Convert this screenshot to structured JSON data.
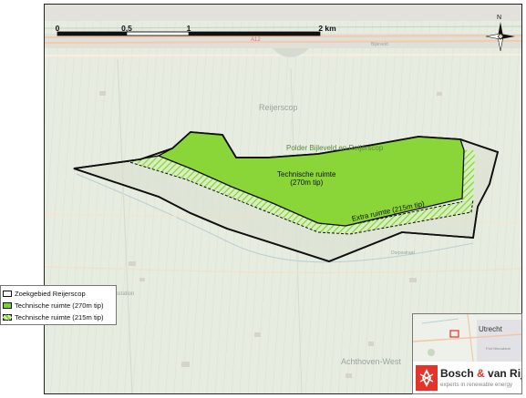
{
  "map": {
    "scale_bar": {
      "ticks": [
        {
          "label": "0"
        },
        {
          "label": "0,5"
        },
        {
          "label": "1"
        },
        {
          "label": "2 km"
        }
      ]
    },
    "north_label": "N",
    "place_labels": {
      "reijerscop": "Reijerscop",
      "polder": "Polder Bijleveld en Reijerscop",
      "achthoven": "Achthoven-West",
      "road_a12": "A12",
      "pompstation": "Pompstation",
      "bijleveld": "Bijleveld",
      "dorpsstraat": "Dorpsstraat"
    },
    "zone_labels": {
      "technische_270": "Technische ruimte\n(270m tip)",
      "extra_215": "Extra ruimte (215m tip)"
    },
    "colors": {
      "zoekgebied_outline": "#111111",
      "technische_270_fill": "#7ed321",
      "technische_215_hatch": "#7ed321",
      "base_map": "#e7ede0"
    }
  },
  "legend": {
    "items": [
      {
        "label": "Zoekgebied Reijerscop",
        "icon": "outline-square"
      },
      {
        "label": "Technische ruimte (270m tip)",
        "icon": "green-fill-square"
      },
      {
        "label": "Technische ruimte (215m tip)",
        "icon": "green-hatch-square"
      }
    ]
  },
  "inset": {
    "city": "Utrecht",
    "town": "Fort Nieuwland"
  },
  "logo": {
    "name_part1": "Bosch",
    "ampersand": "&",
    "name_part2": "van Rijn",
    "tagline": "experts in renewable energy"
  }
}
